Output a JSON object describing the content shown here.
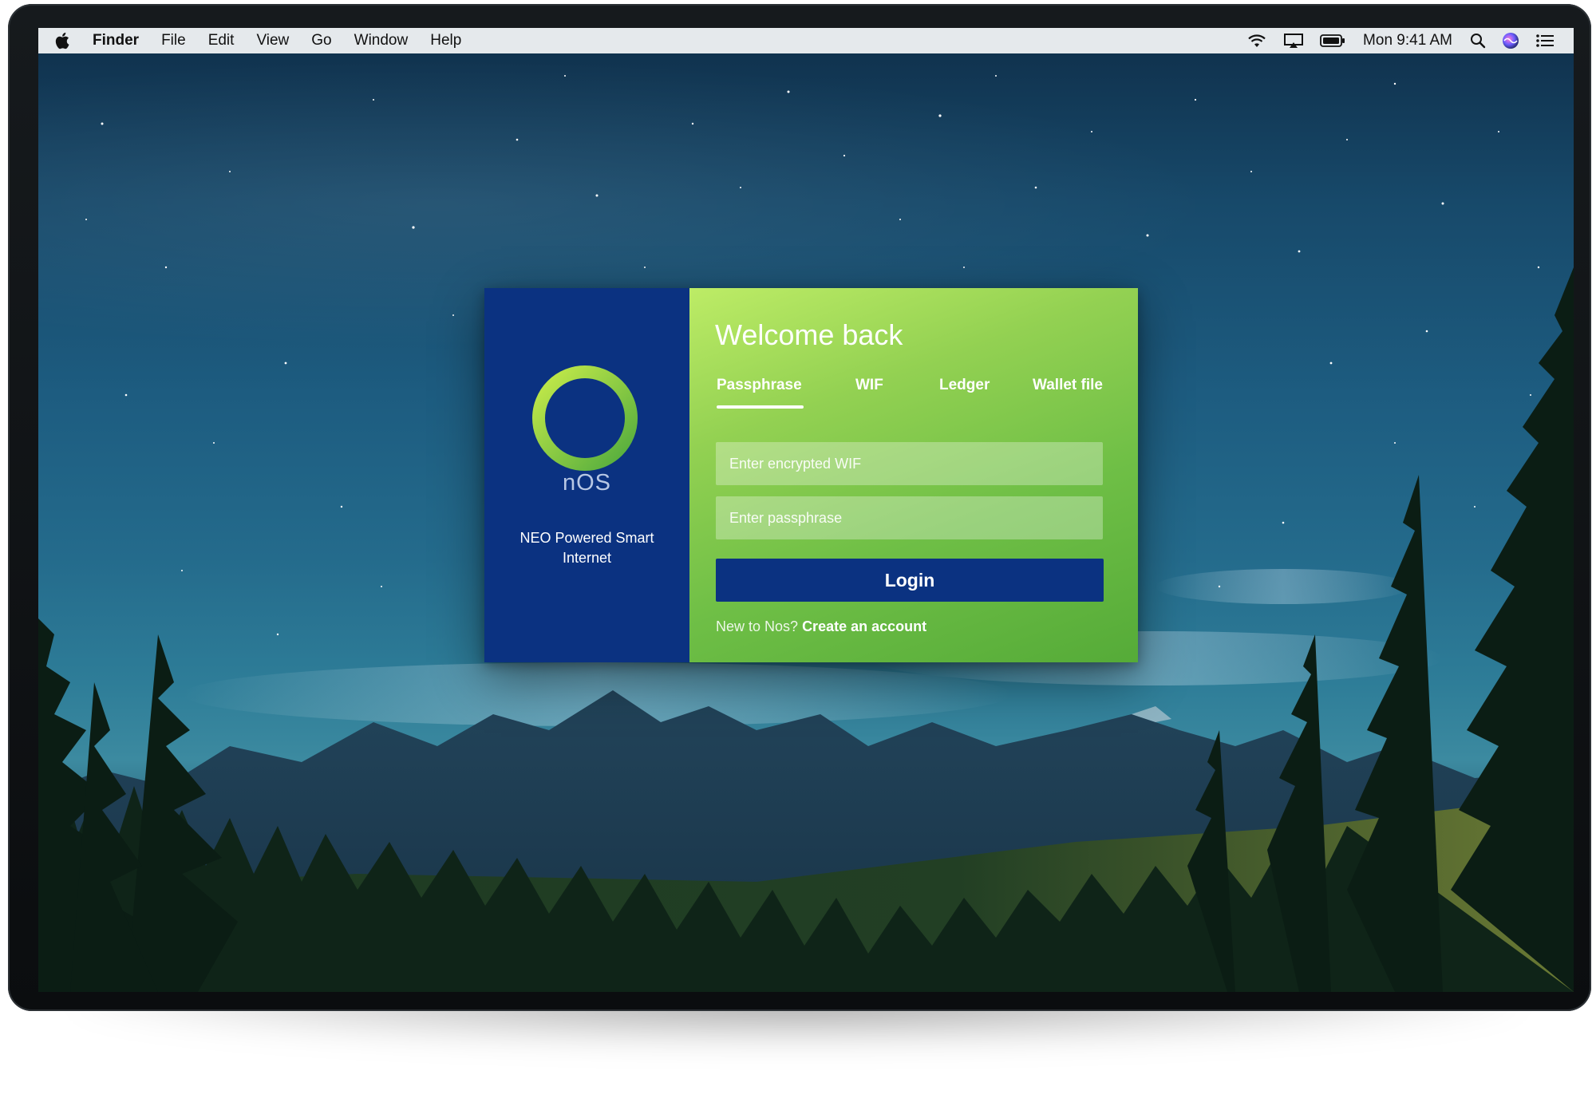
{
  "menubar": {
    "app_name": "Finder",
    "menus": [
      "File",
      "Edit",
      "View",
      "Go",
      "Window",
      "Help"
    ],
    "clock": "Mon 9:41 AM",
    "status_icons": [
      "wifi-icon",
      "airplay-icon",
      "battery-icon",
      "spotlight-search-icon",
      "siri-icon",
      "notification-center-icon"
    ]
  },
  "brand": {
    "logo_text": "nOS",
    "tagline": "NEO Powered Smart Internet"
  },
  "login": {
    "title": "Welcome back",
    "tabs": [
      {
        "label": "Passphrase",
        "active": true
      },
      {
        "label": "WIF",
        "active": false
      },
      {
        "label": "Ledger",
        "active": false
      },
      {
        "label": "Wallet file",
        "active": false
      }
    ],
    "wif_placeholder": "Enter encrypted WIF",
    "wif_value": "",
    "passphrase_placeholder": "Enter passphrase",
    "passphrase_value": "",
    "login_label": "Login",
    "signup_prompt": "New to Nos?",
    "signup_link": "Create an account"
  },
  "colors": {
    "brand_blue": "#0b3281",
    "accent_green": "#6fbf46",
    "light_green": "#bdec66"
  }
}
